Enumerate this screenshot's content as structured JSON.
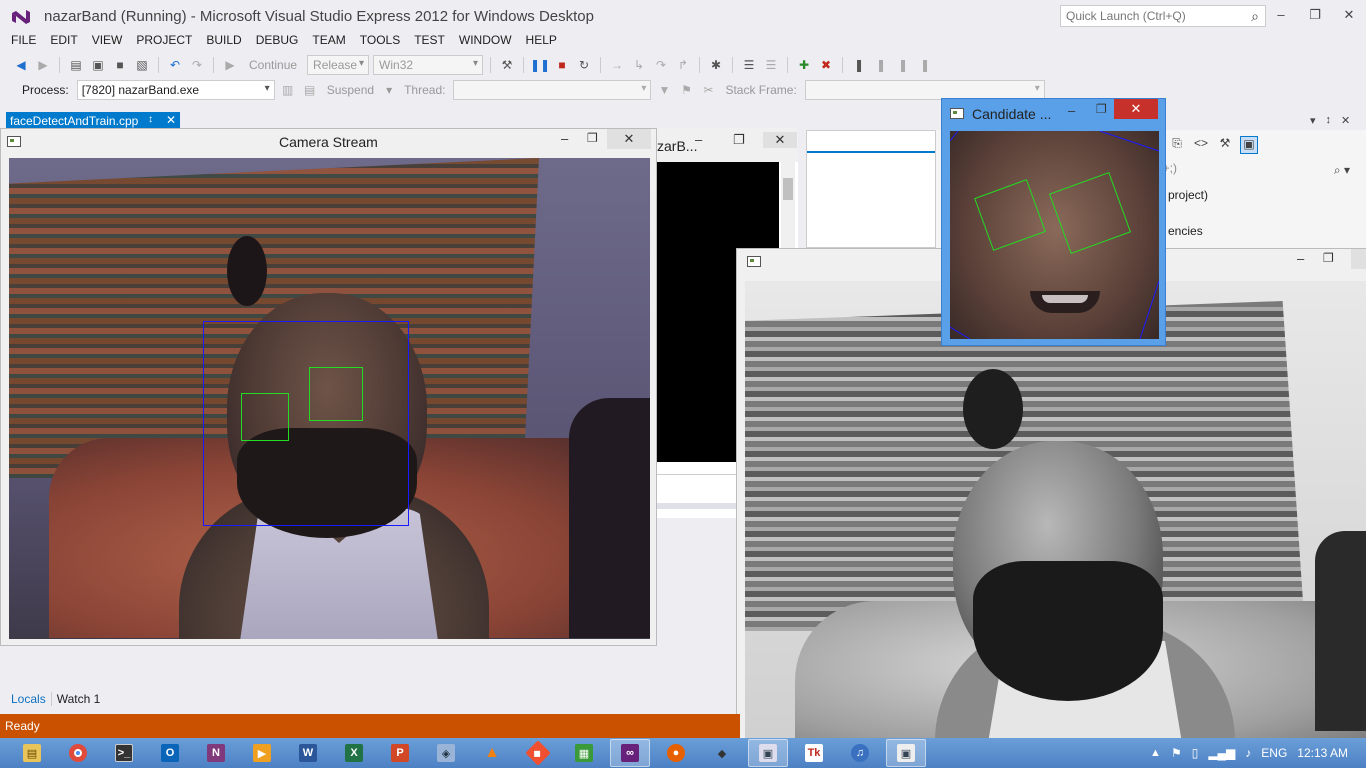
{
  "app": {
    "title": "nazarBand (Running) - Microsoft Visual Studio Express 2012 for Windows Desktop",
    "quick_launch_placeholder": "Quick Launch (Ctrl+Q)"
  },
  "menu": [
    "FILE",
    "EDIT",
    "VIEW",
    "PROJECT",
    "BUILD",
    "DEBUG",
    "TEAM",
    "TOOLS",
    "TEST",
    "WINDOW",
    "HELP"
  ],
  "toolbar": {
    "continue_label": "Continue",
    "config": "Release",
    "platform": "Win32"
  },
  "debug": {
    "process_label": "Process:",
    "process_value": "[7820] nazarBand.exe",
    "suspend_label": "Suspend",
    "thread_label": "Thread:",
    "stack_frame_label": "Stack Frame:"
  },
  "document_tab": {
    "label": "faceDetectAndTrain.cpp"
  },
  "camera_window": {
    "title": "Camera Stream"
  },
  "console_window": {
    "title": "zarB..."
  },
  "candidate_window": {
    "title": "Candidate ..."
  },
  "solution_explorer": {
    "search_fragment": "l+;)",
    "item1": "project)",
    "item2": "encies"
  },
  "bottom_tabs": {
    "locals": "Locals",
    "watch": "Watch 1"
  },
  "status": {
    "text": "Ready",
    "color": "#ca5100"
  },
  "detections": {
    "face_color": "#1a1aff",
    "eye_color": "#22dd22"
  },
  "taskbar": {
    "apps": [
      "file-explorer",
      "chrome",
      "terminal",
      "outlook",
      "onenote",
      "media-player",
      "word",
      "excel",
      "powerpoint",
      "3d-box",
      "vlc",
      "git",
      "network",
      "visual-studio",
      "firefox",
      "cube-app",
      "photo-viewer",
      "tk-app",
      "itunes",
      "opencv-window"
    ],
    "tray": {
      "language": "ENG",
      "time": "12:13 AM"
    }
  }
}
